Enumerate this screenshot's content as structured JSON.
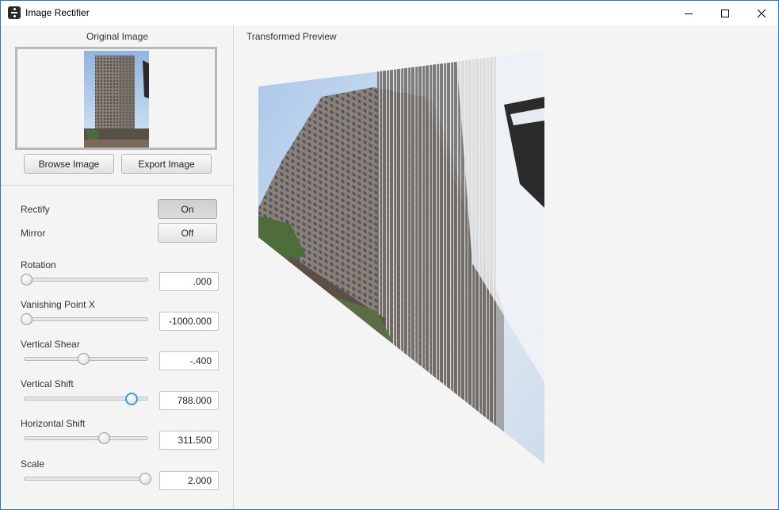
{
  "window": {
    "title": "Image Rectifier",
    "icon": "rectifier-app-icon"
  },
  "original": {
    "label": "Original Image",
    "browse_label": "Browse Image",
    "export_label": "Export Image"
  },
  "toggles": {
    "rectify_label": "Rectify",
    "rectify_value": "On",
    "mirror_label": "Mirror",
    "mirror_value": "Off"
  },
  "sliders": [
    {
      "label": "Rotation",
      "value": ".000",
      "level": 0.0
    },
    {
      "label": "Vanishing Point X",
      "value": "-1000.000",
      "level": 0.0
    },
    {
      "label": "Vertical Shear",
      "value": "-.400",
      "level": 0.48
    },
    {
      "label": "Vertical Shift",
      "value": "788.000",
      "level": 0.88
    },
    {
      "label": "Horizontal Shift",
      "value": "311.500",
      "level": 0.65
    },
    {
      "label": "Scale",
      "value": "2.000",
      "level": 1.0
    }
  ],
  "preview": {
    "label": "Transformed Preview"
  },
  "colors": {
    "accent": "#3ca0d8",
    "window_border": "#2b78c2",
    "panel_bg": "#f4f4f4"
  }
}
